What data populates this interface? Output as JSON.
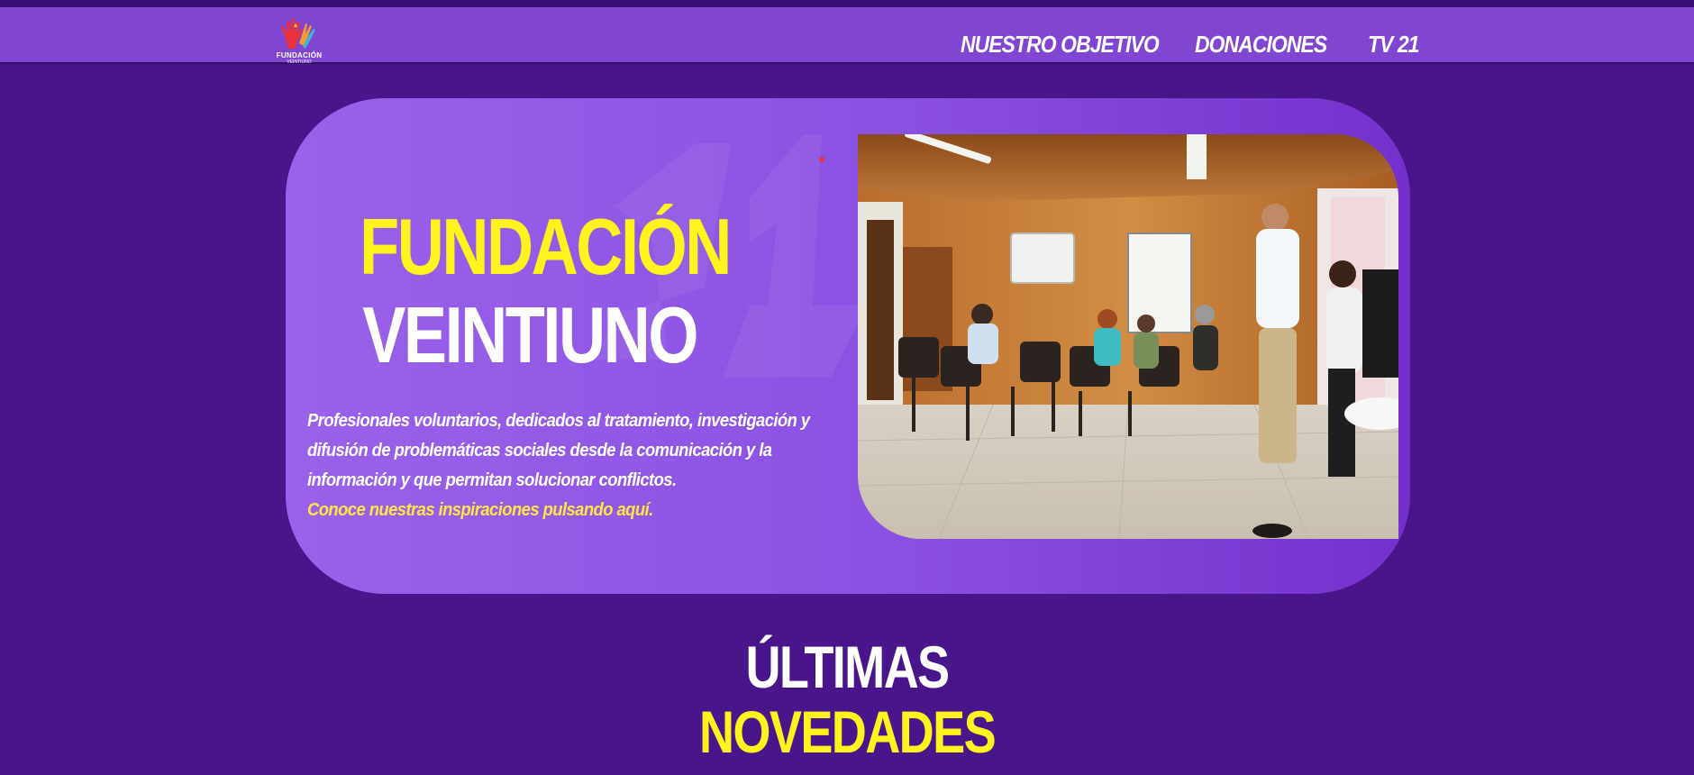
{
  "brand": {
    "logo_name": "FUNDACIÓN",
    "logo_sub": "VEINTIUNO"
  },
  "nav": {
    "items": [
      {
        "label": "NUESTRO OBJETIVO"
      },
      {
        "label": "DONACIONES"
      },
      {
        "label": "TV 21"
      }
    ]
  },
  "hero": {
    "title_line1": "FUNDACIÓN",
    "title_line2": "VEINTIUNO",
    "description": "Profesionales voluntarios, dedicados al tratamiento, investigación y difusión de problemáticas sociales desde la comunicación y la información y que permitan solucionar conflictos.",
    "link": "Conoce nuestras inspiraciones pulsando aquí.",
    "photo_icon": "group-meeting-photo"
  },
  "section": {
    "title_line1": "ÚLTIMAS",
    "title_line2": "NOVEDADES"
  },
  "colors": {
    "background": "#48158b",
    "navbar": "#8045d1",
    "hero": "#8a50e2",
    "accent_yellow": "#fff21d",
    "link_yellow": "#ffe645"
  }
}
